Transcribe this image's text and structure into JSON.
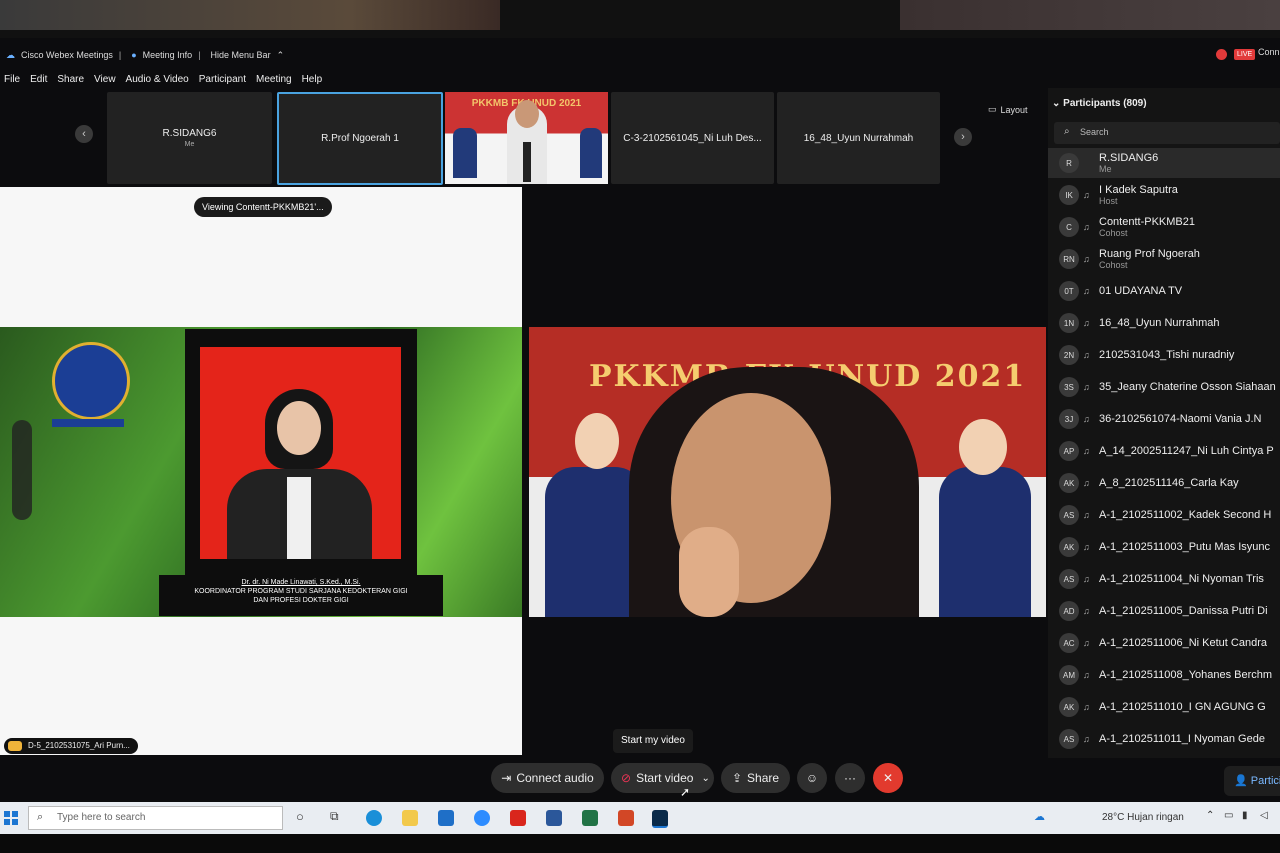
{
  "titlebar": {
    "app": "Cisco Webex Meetings",
    "meeting_info": "Meeting Info",
    "hide_menu": "Hide Menu Bar",
    "live": "LIVE",
    "connected": "Conn"
  },
  "menu": [
    "File",
    "Edit",
    "Share",
    "View",
    "Audio & Video",
    "Participant",
    "Meeting",
    "Help"
  ],
  "filmstrip": {
    "tiles": [
      {
        "name": "R.SIDANG6",
        "sub": "Me"
      },
      {
        "name": "R.Prof Ngoerah 1"
      },
      {
        "name": "",
        "banner": "PKKMB FK UNUD 2021"
      },
      {
        "name": "C-3-2102561045_Ni Luh Des..."
      },
      {
        "name": "16_48_Uyun Nurrahmah"
      }
    ],
    "layout_label": "Layout"
  },
  "share": {
    "viewing_label": "Viewing Contentt-PKKMB21'...",
    "caption_name": "Dr. dr. Ni Made Linawati, S.Ked., M.Si.",
    "caption_line2": "KOORDINATOR PROGRAM STUDI SARJANA KEDOKTERAN GIGI",
    "caption_line3": "DAN PROFESI DOKTER GIGI",
    "bottom_name": "D-5_2102531075_Ari Purn..."
  },
  "video": {
    "banner": "PKKMB FK UNUD 2021"
  },
  "participants": {
    "header": "Participants (809)",
    "search_placeholder": "Search",
    "list": [
      {
        "av": "R",
        "name": "R.SIDANG6",
        "role": "Me"
      },
      {
        "av": "IK",
        "name": "I Kadek Saputra",
        "role": "Host"
      },
      {
        "av": "C",
        "name": "Contentt-PKKMB21",
        "role": "Cohost"
      },
      {
        "av": "RN",
        "name": "Ruang Prof Ngoerah",
        "role": "Cohost"
      },
      {
        "av": "0T",
        "name": "01 UDAYANA TV",
        "role": ""
      },
      {
        "av": "1N",
        "name": "16_48_Uyun Nurrahmah",
        "role": ""
      },
      {
        "av": "2N",
        "name": "2102531043_Tishi nuradniy",
        "role": ""
      },
      {
        "av": "3S",
        "name": "35_Jeany Chaterine Osson Siahaan",
        "role": ""
      },
      {
        "av": "3J",
        "name": "36-2102561074-Naomi Vania J.N",
        "role": ""
      },
      {
        "av": "AP",
        "name": "A_14_2002511247_Ni Luh Cintya P",
        "role": ""
      },
      {
        "av": "AK",
        "name": "A_8_2102511146_Carla Kay",
        "role": ""
      },
      {
        "av": "AS",
        "name": "A-1_2102511002_Kadek Second H",
        "role": ""
      },
      {
        "av": "AK",
        "name": "A-1_2102511003_Putu Mas Isyunc",
        "role": ""
      },
      {
        "av": "AS",
        "name": "A-1_2102511004_Ni Nyoman Tris",
        "role": ""
      },
      {
        "av": "AD",
        "name": "A-1_2102511005_Danissa Putri Di",
        "role": ""
      },
      {
        "av": "AC",
        "name": "A-1_2102511006_Ni Ketut Candra",
        "role": ""
      },
      {
        "av": "AM",
        "name": "A-1_2102511008_Yohanes Berchm",
        "role": ""
      },
      {
        "av": "AK",
        "name": "A-1_2102511010_I GN AGUNG G",
        "role": ""
      },
      {
        "av": "AS",
        "name": "A-1_2102511011_I Nyoman Gede",
        "role": ""
      }
    ],
    "button": "Partici"
  },
  "controls": {
    "tooltip": "Start my video",
    "connect_audio": "Connect audio",
    "start_video": "Start video",
    "share": "Share",
    "more": "···",
    "end": "✕"
  },
  "taskbar": {
    "search_placeholder": "Type here to search",
    "weather": "28°C  Hujan ringan"
  }
}
